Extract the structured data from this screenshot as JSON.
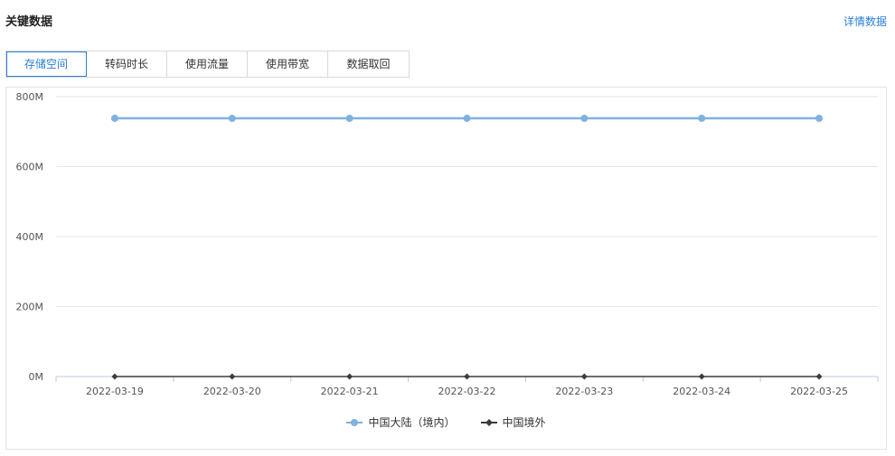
{
  "header": {
    "title": "关键数据",
    "detail_link": "详情数据"
  },
  "tabs": [
    {
      "label": "存储空间",
      "active": true
    },
    {
      "label": "转码时长",
      "active": false
    },
    {
      "label": "使用流量",
      "active": false
    },
    {
      "label": "使用带宽",
      "active": false
    },
    {
      "label": "数据取回",
      "active": false
    }
  ],
  "colors": {
    "accent": "#2a7ed6",
    "series_mainland": "#7fb1e0",
    "series_overseas": "#3d3d3d",
    "grid": "#e6e6e6"
  },
  "chart_data": {
    "type": "line",
    "x": [
      "2022-03-19",
      "2022-03-20",
      "2022-03-21",
      "2022-03-22",
      "2022-03-23",
      "2022-03-24",
      "2022-03-25"
    ],
    "y_ticks": [
      "0M",
      "200M",
      "400M",
      "600M",
      "800M"
    ],
    "ylim": [
      0,
      800
    ],
    "y_unit": "M",
    "grid": true,
    "legend_position": "bottom-center",
    "series": [
      {
        "name": "中国大陆（境内）",
        "values": [
          738,
          738,
          738,
          738,
          738,
          738,
          738
        ],
        "marker": "circle",
        "color": "#7fb1e0"
      },
      {
        "name": "中国境外",
        "values": [
          0,
          0,
          0,
          0,
          0,
          0,
          0
        ],
        "marker": "diamond",
        "color": "#3d3d3d"
      }
    ]
  }
}
